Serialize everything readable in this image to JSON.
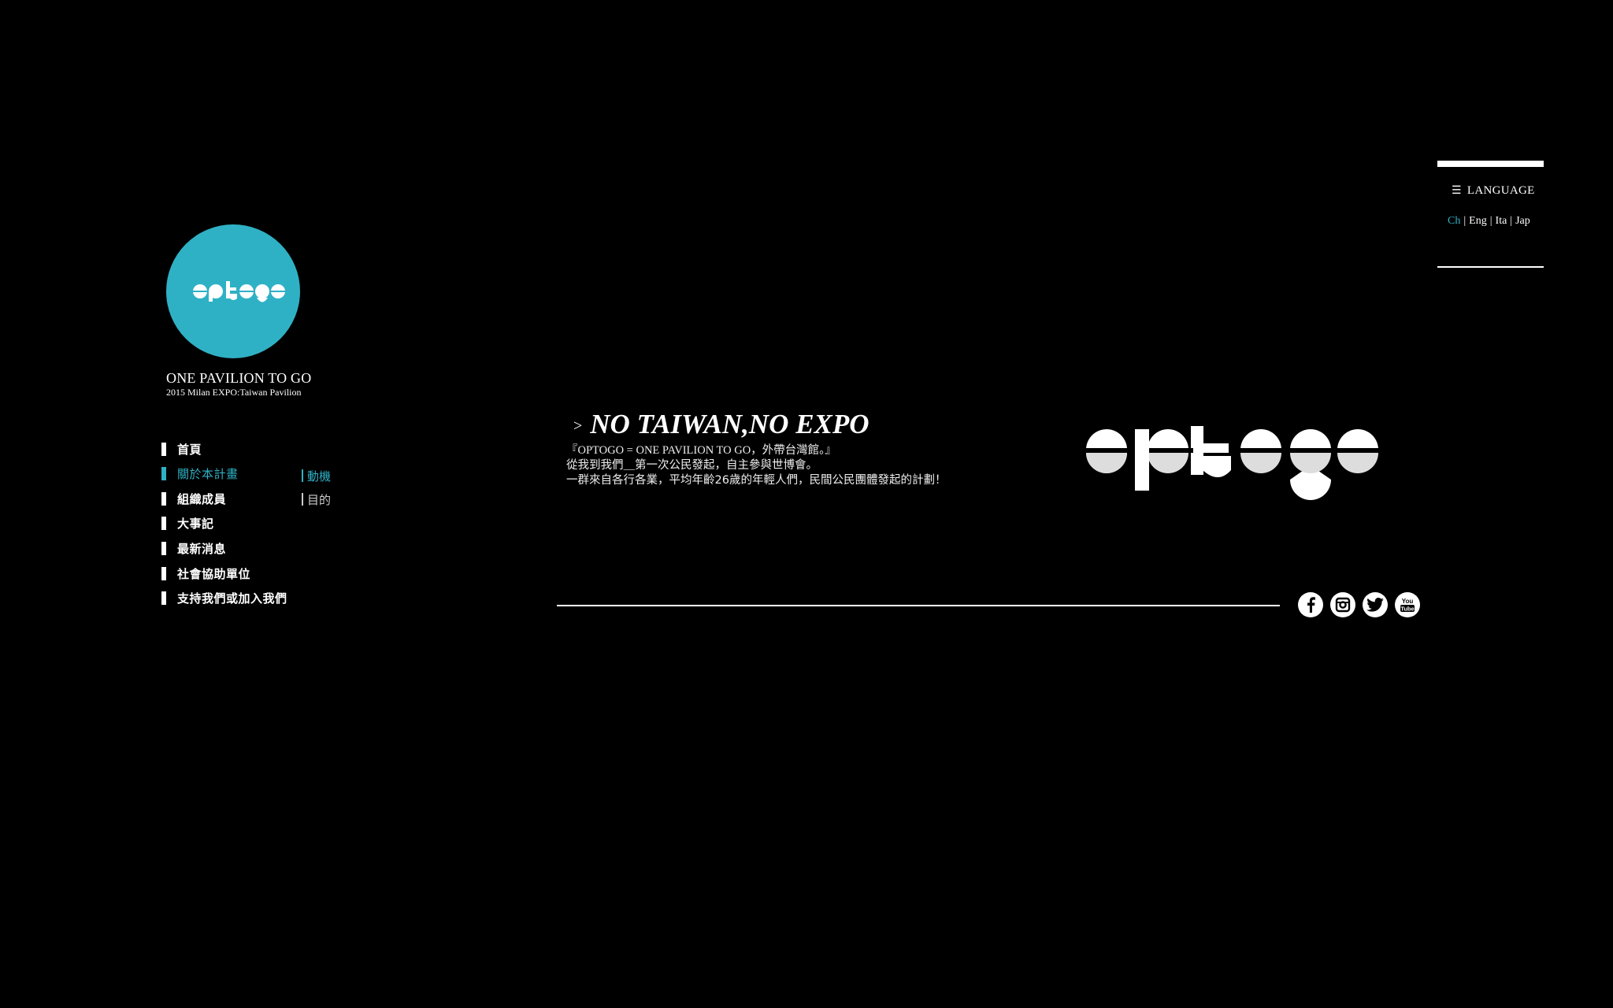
{
  "brand": {
    "logo_text": "optogo",
    "title": "ONE PAVILION TO GO",
    "subtitle": "2015 Milan EXPO:Taiwan Pavilion"
  },
  "nav": {
    "items": [
      {
        "label": "首頁",
        "active": false
      },
      {
        "label": "關於本計畫",
        "active": true
      },
      {
        "label": "組織成員",
        "active": false
      },
      {
        "label": "大事記",
        "active": false
      },
      {
        "label": "最新消息",
        "active": false
      },
      {
        "label": "社會協助單位",
        "active": false
      },
      {
        "label": "支持我們或加入我們",
        "active": false
      }
    ],
    "subitems": [
      {
        "label": "動機",
        "active": true
      },
      {
        "label": "目的",
        "active": false
      }
    ]
  },
  "main": {
    "arrow": ">",
    "headline": "NO TAIWAN,NO EXPO",
    "line1": "『OPTOGO = ONE PAVILION TO GO，外帶台灣館。』",
    "line2": "從我到我們＿第一次公民發起，自主參與世博會。",
    "line3": "一群來自各行各業，平均年齡26歲的年輕人們，民間公民團體發起的計劃！",
    "logo_text": "optogo"
  },
  "social": [
    {
      "icon": "facebook-icon"
    },
    {
      "icon": "instagram-icon"
    },
    {
      "icon": "twitter-icon"
    },
    {
      "icon": "youtube-icon"
    }
  ],
  "language": {
    "title": "LANGUAGE",
    "icon": "menu-icon",
    "options": [
      "Ch",
      "Eng",
      "Ita",
      "Jap"
    ],
    "selected": "Ch",
    "separator": "|"
  },
  "colors": {
    "background": "#000000",
    "accent": "#2fb1c5",
    "text": "#ffffff"
  }
}
